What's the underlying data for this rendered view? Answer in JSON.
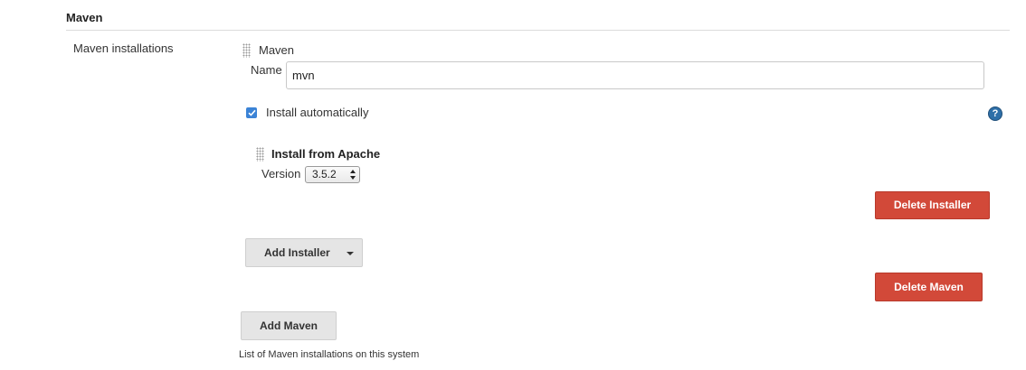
{
  "section": {
    "title": "Maven",
    "row_label": "Maven installations",
    "description": "List of Maven installations on this system"
  },
  "maven": {
    "block_title": "Maven",
    "name_label": "Name",
    "name_value": "mvn",
    "install_auto_label": "Install automatically",
    "install_auto_checked": true,
    "installer": {
      "title": "Install from Apache",
      "version_label": "Version",
      "version_value": "3.5.2"
    },
    "delete_installer_label": "Delete Installer",
    "add_installer_label": "Add Installer",
    "delete_maven_label": "Delete Maven"
  },
  "add_maven_label": "Add Maven",
  "icons": {
    "help": "help-icon",
    "drag": "drag-handle-icon",
    "check": "checkmark-icon",
    "caret": "caret-down-icon"
  },
  "colors": {
    "danger": "#d24939",
    "accent": "#3b83d6",
    "help": "#2e6fa8"
  }
}
